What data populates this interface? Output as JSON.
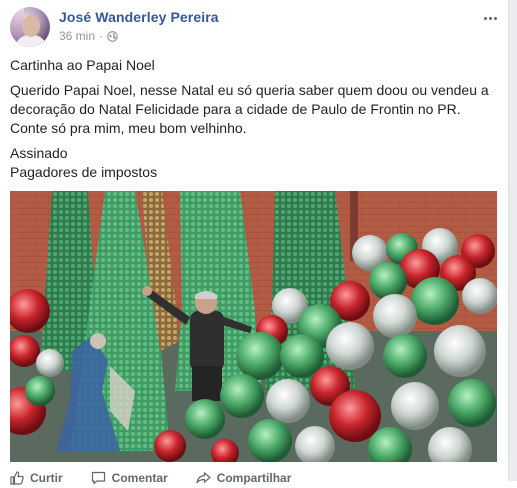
{
  "post": {
    "author": "José Wanderley Pereira",
    "timestamp": "36 min",
    "separator": "·",
    "privacy_icon": "globe-icon",
    "menu_icon": "more-options-icon",
    "title": "Cartinha ao Papai Noel",
    "body": "Querido Papai Noel, nesse Natal eu só queria saber quem doou ou vendeu a decoração do Natal Felicidade para a cidade de Paulo de Frontin no PR. Conte só pra mim, meu bom velhinho.",
    "signature_line1": "Assinado",
    "signature_line2": "Pagadores de impostos"
  },
  "actions": {
    "like": "Curtir",
    "comment": "Comentar",
    "share": "Compartilhar"
  },
  "colors": {
    "author_link": "#365899",
    "meta": "#90949c",
    "text": "#1d2129",
    "action": "#616770"
  }
}
